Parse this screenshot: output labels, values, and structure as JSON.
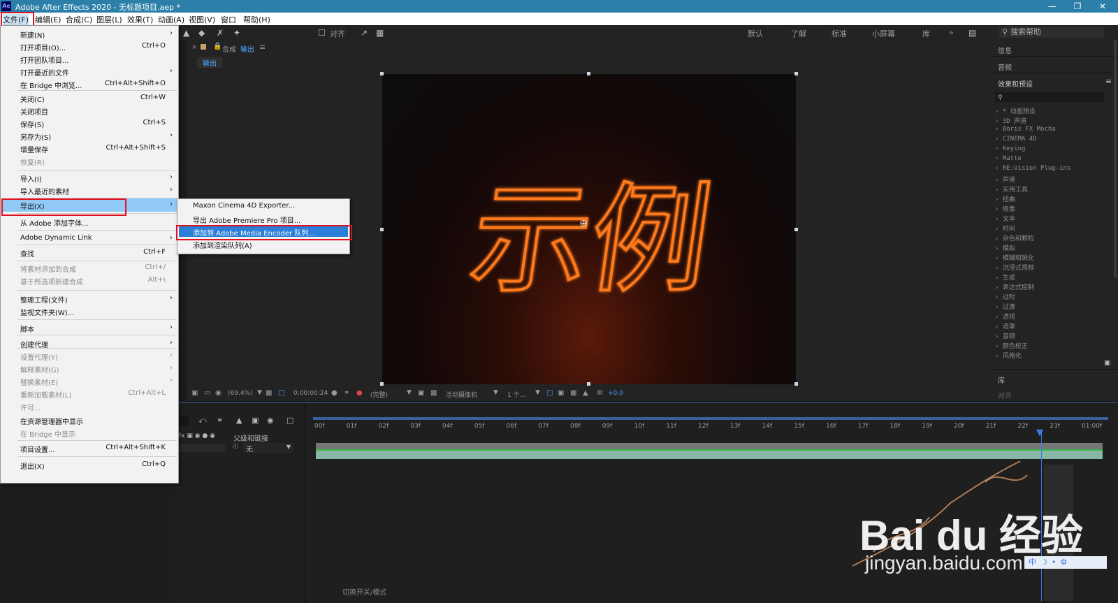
{
  "window": {
    "title": "Adobe After Effects 2020 - 无标题项目.aep *",
    "app_icon": "Ae"
  },
  "menubar": [
    "文件(F)",
    "编辑(E)",
    "合成(C)",
    "图层(L)",
    "效果(T)",
    "动画(A)",
    "视图(V)",
    "窗口",
    "帮助(H)"
  ],
  "toolbar": {
    "snap_label": "对齐",
    "workspaces": [
      "默认",
      "了解",
      "标准",
      "小屏幕",
      "库"
    ],
    "search_placeholder": "搜索帮助"
  },
  "comp_panel": {
    "tab_prefix": "合成",
    "tab_name": "输出",
    "breadcrumb": "输出",
    "artwork_text": "示例",
    "footer": {
      "zoom": "(69.4%)",
      "timecode": "0:00:00:24",
      "resolution": "(完整)",
      "camera": "活动摄像机",
      "views": "1 个...",
      "exposure": "+0.0"
    }
  },
  "right_panel": {
    "info": "信息",
    "audio": "音频",
    "effects_title": "效果和预设",
    "effects": [
      "* 动画预设",
      "3D 声道",
      "Boris FX Mocha",
      "CINEMA 4D",
      "Keying",
      "Matte",
      "RE:Vision Plug-ins",
      "声道",
      "实用工具",
      "扭曲",
      "抠像",
      "文本",
      "时间",
      "杂色和颗粒",
      "模拟",
      "模糊和锐化",
      "沉浸式视频",
      "生成",
      "表达式控制",
      "过时",
      "过渡",
      "透视",
      "遮罩",
      "音频",
      "颜色校正",
      "风格化"
    ],
    "library": "库",
    "align": "对齐"
  },
  "timeline": {
    "ruler_ticks": [
      "00f",
      "01f",
      "02f",
      "03f",
      "04f",
      "05f",
      "06f",
      "07f",
      "08f",
      "09f",
      "10f",
      "11f",
      "12f",
      "13f",
      "14f",
      "15f",
      "16f",
      "17f",
      "18f",
      "19f",
      "20f",
      "21f",
      "22f",
      "23f",
      "01:00f"
    ],
    "parent_label": "父级和链接",
    "parent_value": "无",
    "footer_label": "切换开关/模式"
  },
  "file_menu": [
    {
      "label": "新建(N)",
      "shortcut": "",
      "submenu": true,
      "disabled": false
    },
    {
      "label": "打开项目(O)...",
      "shortcut": "Ctrl+O",
      "submenu": false,
      "disabled": false
    },
    {
      "label": "打开团队项目...",
      "shortcut": "",
      "submenu": false,
      "disabled": false
    },
    {
      "label": "打开最近的文件",
      "shortcut": "",
      "submenu": true,
      "disabled": false
    },
    {
      "label": "在 Bridge 中浏览...",
      "shortcut": "Ctrl+Alt+Shift+O",
      "submenu": false,
      "disabled": false
    },
    {
      "label": "关闭(C)",
      "shortcut": "Ctrl+W",
      "submenu": false,
      "disabled": false
    },
    {
      "label": "关闭项目",
      "shortcut": "",
      "submenu": false,
      "disabled": false
    },
    {
      "label": "保存(S)",
      "shortcut": "Ctrl+S",
      "submenu": false,
      "disabled": false
    },
    {
      "label": "另存为(S)",
      "shortcut": "",
      "submenu": true,
      "disabled": false
    },
    {
      "label": "增量保存",
      "shortcut": "Ctrl+Alt+Shift+S",
      "submenu": false,
      "disabled": false
    },
    {
      "label": "恢复(R)",
      "shortcut": "",
      "submenu": false,
      "disabled": true
    },
    {
      "label": "导入(I)",
      "shortcut": "",
      "submenu": true,
      "disabled": false
    },
    {
      "label": "导入最近的素材",
      "shortcut": "",
      "submenu": true,
      "disabled": false
    },
    {
      "label": "导出(X)",
      "shortcut": "",
      "submenu": true,
      "disabled": false,
      "highlighted": true
    },
    {
      "label": "从 Adobe 添加字体...",
      "shortcut": "",
      "submenu": false,
      "disabled": false
    },
    {
      "label": "Adobe Dynamic Link",
      "shortcut": "",
      "submenu": true,
      "disabled": false
    },
    {
      "label": "查找",
      "shortcut": "Ctrl+F",
      "submenu": false,
      "disabled": false
    },
    {
      "label": "将素材添加到合成",
      "shortcut": "Ctrl+/",
      "submenu": false,
      "disabled": true
    },
    {
      "label": "基于所选项新建合成",
      "shortcut": "Alt+\\",
      "submenu": false,
      "disabled": true
    },
    {
      "label": "整理工程(文件)",
      "shortcut": "",
      "submenu": true,
      "disabled": false
    },
    {
      "label": "监视文件夹(W)...",
      "shortcut": "",
      "submenu": false,
      "disabled": false
    },
    {
      "label": "脚本",
      "shortcut": "",
      "submenu": true,
      "disabled": false
    },
    {
      "label": "创建代理",
      "shortcut": "",
      "submenu": true,
      "disabled": false
    },
    {
      "label": "设置代理(Y)",
      "shortcut": "",
      "submenu": true,
      "disabled": true
    },
    {
      "label": "解释素材(G)",
      "shortcut": "",
      "submenu": true,
      "disabled": true
    },
    {
      "label": "替换素材(E)",
      "shortcut": "",
      "submenu": true,
      "disabled": true
    },
    {
      "label": "重新加载素材(L)",
      "shortcut": "Ctrl+Alt+L",
      "submenu": false,
      "disabled": true
    },
    {
      "label": "许可...",
      "shortcut": "",
      "submenu": false,
      "disabled": true
    },
    {
      "label": "在资源管理器中显示",
      "shortcut": "",
      "submenu": false,
      "disabled": false
    },
    {
      "label": "在 Bridge 中显示",
      "shortcut": "",
      "submenu": false,
      "disabled": true
    },
    {
      "label": "项目设置...",
      "shortcut": "Ctrl+Alt+Shift+K",
      "submenu": false,
      "disabled": false
    },
    {
      "label": "退出(X)",
      "shortcut": "Ctrl+Q",
      "submenu": false,
      "disabled": false
    }
  ],
  "export_submenu": [
    {
      "label": "Maxon Cinema 4D Exporter..."
    },
    {
      "label": "导出 Adobe Premiere Pro 项目..."
    },
    {
      "label": "添加到 Adobe Media Encoder 队列...",
      "highlighted": true
    },
    {
      "label": "添加到渲染队列(A)"
    }
  ],
  "watermark": {
    "brand": "Bai du 经验",
    "url": "jingyan.baidu.com",
    "signature": "雅兰学波"
  },
  "colors": {
    "titlebar": "#2b7fa8",
    "menu_highlight": "#91c9f7",
    "callout": "#e01020",
    "text_stroke": "#ff7a1a",
    "timeline_bar": "#87b8a6"
  }
}
